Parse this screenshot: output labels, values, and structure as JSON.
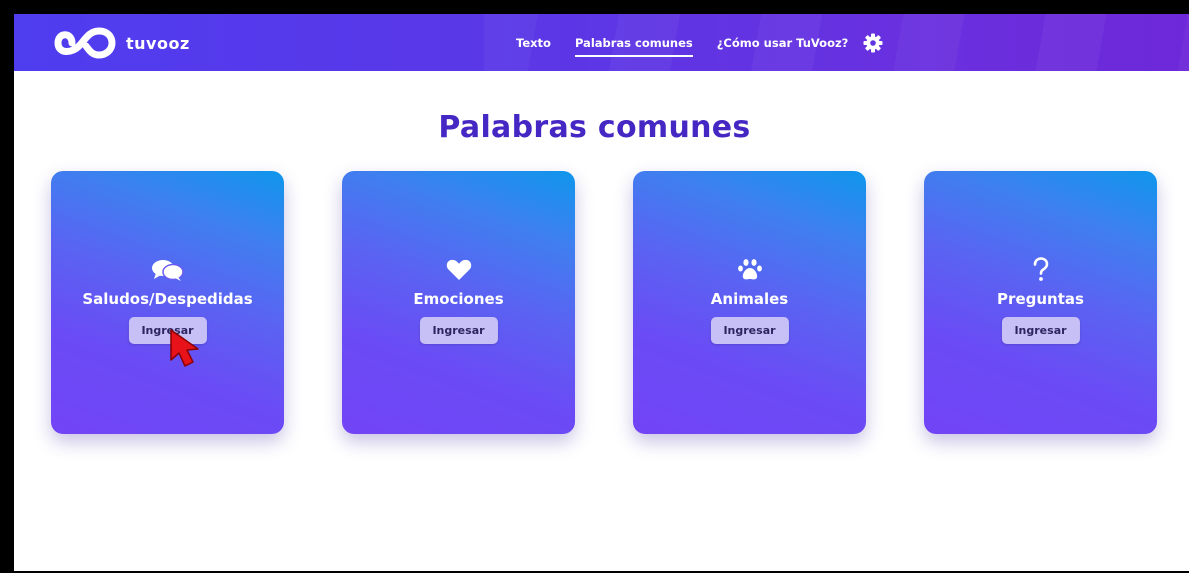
{
  "header": {
    "logo_text": "tuvooz",
    "nav": [
      {
        "label": "Texto",
        "active": false
      },
      {
        "label": "Palabras comunes",
        "active": true
      },
      {
        "label": "¿Cómo usar TuVooz?",
        "active": false
      }
    ],
    "settings_icon": "gear-icon"
  },
  "main": {
    "title": "Palabras comunes",
    "cards": [
      {
        "title": "Saludos/Despedidas",
        "icon": "chat-bubbles-icon",
        "button": "Ingresar"
      },
      {
        "title": "Emociones",
        "icon": "heart-icon",
        "button": "Ingresar"
      },
      {
        "title": "Animales",
        "icon": "paw-icon",
        "button": "Ingresar"
      },
      {
        "title": "Preguntas",
        "icon": "question-icon",
        "button": "Ingresar"
      }
    ]
  },
  "colors": {
    "navbar": "#5b37e6",
    "title": "#4527c4",
    "card_top": "#0f96ec",
    "card_bottom": "#7244f6",
    "button_bg": "#c7c0f7",
    "cursor": "#e8131a"
  }
}
